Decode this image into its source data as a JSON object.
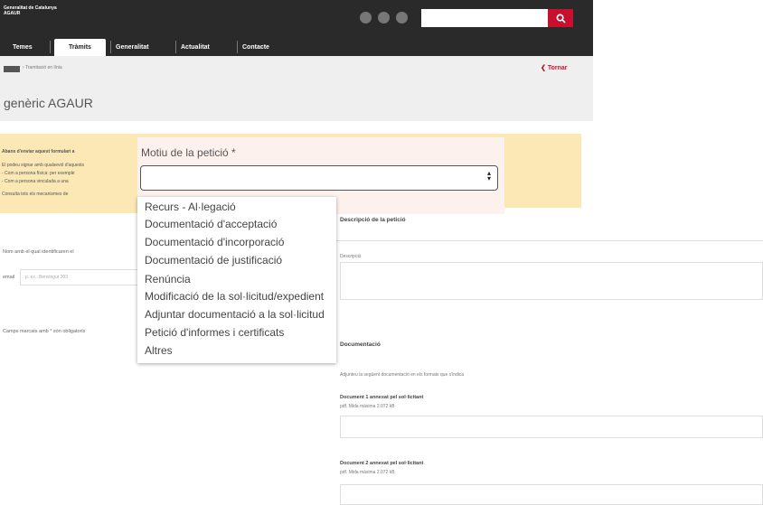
{
  "header": {
    "brand_line1": "Generalitat de Catalunya",
    "brand_line2": "AGAUR",
    "search_placeholder": ""
  },
  "nav": {
    "items": [
      "Temes",
      "Tràmits",
      "Generalitat",
      "Actualitat",
      "Contacte"
    ],
    "active": "Tràmits"
  },
  "breadcrumb": {
    "home": "Inici",
    "current": "Tramitació en línia",
    "back": "Tornar"
  },
  "page": {
    "title": "genèric AGAUR"
  },
  "notice": {
    "line1": "Abans d'enviar aquest formulari a",
    "line2": "El podeu signar amb qualsevol d'aquests",
    "line3": "- Com a persona física: per exemple",
    "line4": "- Com a persona vinculada a una",
    "line5": "Consulta tots els mecanismes de"
  },
  "left_form": {
    "identify_label": "Nom amb el qual identificaren el",
    "email_label": "email",
    "email_placeholder": "p. ex.: Benvingut 203",
    "required_note": "Camps marcats amb * són obligatoris"
  },
  "motiu": {
    "label": "Motiu de la petició *",
    "selected": "",
    "options": [
      "Recurs - Al·legació",
      "Documentació d'acceptació",
      "Documentació d'incorporació",
      "Documentació de justificació",
      "Renúncia",
      "Modificació de la sol·licitud/expedient",
      "Adjuntar documentació a la sol·licitud",
      "Petició d'informes i certificats",
      "Altres"
    ]
  },
  "right_panel": {
    "descripcio_title": "Descripció de la petició",
    "descripcio_label": "Descripció",
    "documentacio_title": "Documentació",
    "documentacio_hint": "Adjunteu la següent documentació en els formats que s'indica",
    "doc1_label": "Document 1 annexat pel sol·licitant",
    "doc1_hint": "pdf. Mida màxima 2.072 kB",
    "doc2_label": "Document 2 annexat pel sol·licitant",
    "doc2_hint": "pdf. Mida màxima 2.072 kB"
  },
  "colors": {
    "brand_red": "#c8102e",
    "header_dark": "#2a2a2a",
    "notice_yellow": "#fbe8b4"
  }
}
